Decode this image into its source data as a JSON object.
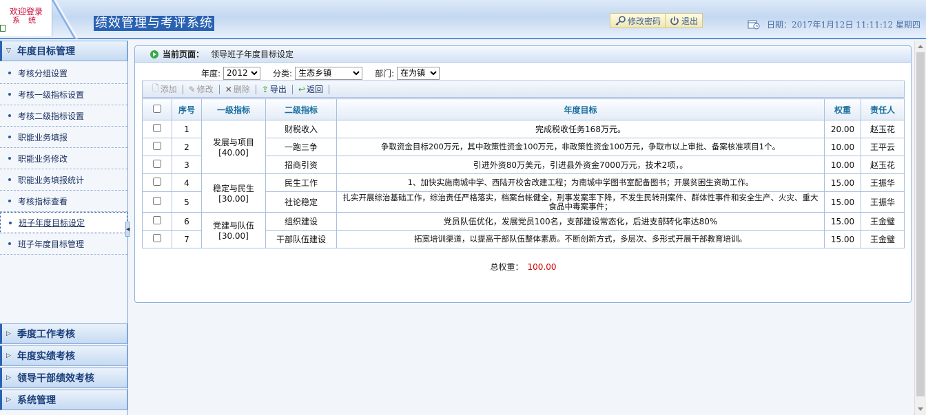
{
  "header": {
    "logo_line1": "欢迎登录",
    "logo_line2": "系统",
    "title": "绩效管理与考评系统",
    "change_password": "修改密码",
    "logout": "退出",
    "date_text": "日期：2017年1月12日  11:11:12 星期四"
  },
  "sidebar": {
    "sections": [
      {
        "label": "年度目标管理"
      },
      {
        "label": "季度工作考核"
      },
      {
        "label": "年度实绩考核"
      },
      {
        "label": "领导干部绩效考核"
      },
      {
        "label": "系统管理"
      }
    ],
    "items": [
      {
        "label": "考核分组设置"
      },
      {
        "label": "考核一级指标设置"
      },
      {
        "label": "考核二级指标设置"
      },
      {
        "label": "职能业务填报"
      },
      {
        "label": "职能业务修改"
      },
      {
        "label": "职能业务填报统计"
      },
      {
        "label": "考核指标查看"
      },
      {
        "label": "班子年度目标设定"
      },
      {
        "label": "班子年度目标管理"
      }
    ]
  },
  "breadcrumb": {
    "prefix": "当前页面：",
    "page": "领导班子年度目标设定"
  },
  "filters": {
    "year_label": "年度:",
    "year_value": "2012",
    "category_label": "分类:",
    "category_value": "生态乡镇",
    "dept_label": "部门:",
    "dept_value": "在为镇"
  },
  "toolbar": {
    "add": "添加",
    "edit": "修改",
    "delete": "删除",
    "export": "导出",
    "back": "返回"
  },
  "table": {
    "headers": [
      "序号",
      "一级指标",
      "二级指标",
      "年度目标",
      "权重",
      "责任人"
    ],
    "groups": [
      {
        "name": "发展与项目",
        "weight": "[40.00]"
      },
      {
        "name": "稳定与民生",
        "weight": "[30.00]"
      },
      {
        "name": "党建与队伍",
        "weight": "[30.00]"
      }
    ],
    "rows": [
      {
        "no": "1",
        "sub": "财税收入",
        "goal": "完成税收任务168万元。",
        "weight": "20.00",
        "owner": "赵玉花"
      },
      {
        "no": "2",
        "sub": "一跑三争",
        "goal": "争取资金目标200万元，其中政策性资金100万元，非政策性资金100万元，争取市以上审批、备案核准项目1个。",
        "weight": "10.00",
        "owner": "王平云"
      },
      {
        "no": "3",
        "sub": "招商引资",
        "goal": "引进外资80万美元，引进县外资金7000万元，技术2项，。",
        "weight": "10.00",
        "owner": "赵玉花"
      },
      {
        "no": "4",
        "sub": "民生工作",
        "goal": "1、加快实施南城中学、西陆开校舍改建工程；为南城中学图书室配备图书；开展贫困生资助工作。",
        "weight": "15.00",
        "owner": "王振华"
      },
      {
        "no": "5",
        "sub": "社论稳定",
        "goal": "扎实开展综治基础工作，综治责任严格落实，档案台帐健全，刑事发案率下降，不发生民转刑案件、群体性事件和安全生产、火灾、重大食品中毒案事件；",
        "weight": "15.00",
        "owner": "王振华"
      },
      {
        "no": "6",
        "sub": "组织建设",
        "goal": "党员队伍优化，发展党员100名，支部建设常态化，后进支部转化率达80%",
        "weight": "15.00",
        "owner": "王金璧"
      },
      {
        "no": "7",
        "sub": "干部队伍建设",
        "goal": "拓宽培训渠道，以提高干部队伍整体素质。不断创新方式，多层次、多形式开展干部教育培训。",
        "weight": "15.00",
        "owner": "王金璧"
      }
    ]
  },
  "total": {
    "label": "总权重：",
    "value": "100.00"
  },
  "colors": {
    "accent": "#2a62b3",
    "total_value": "#d10000",
    "header_text": "#1a6fa0"
  }
}
